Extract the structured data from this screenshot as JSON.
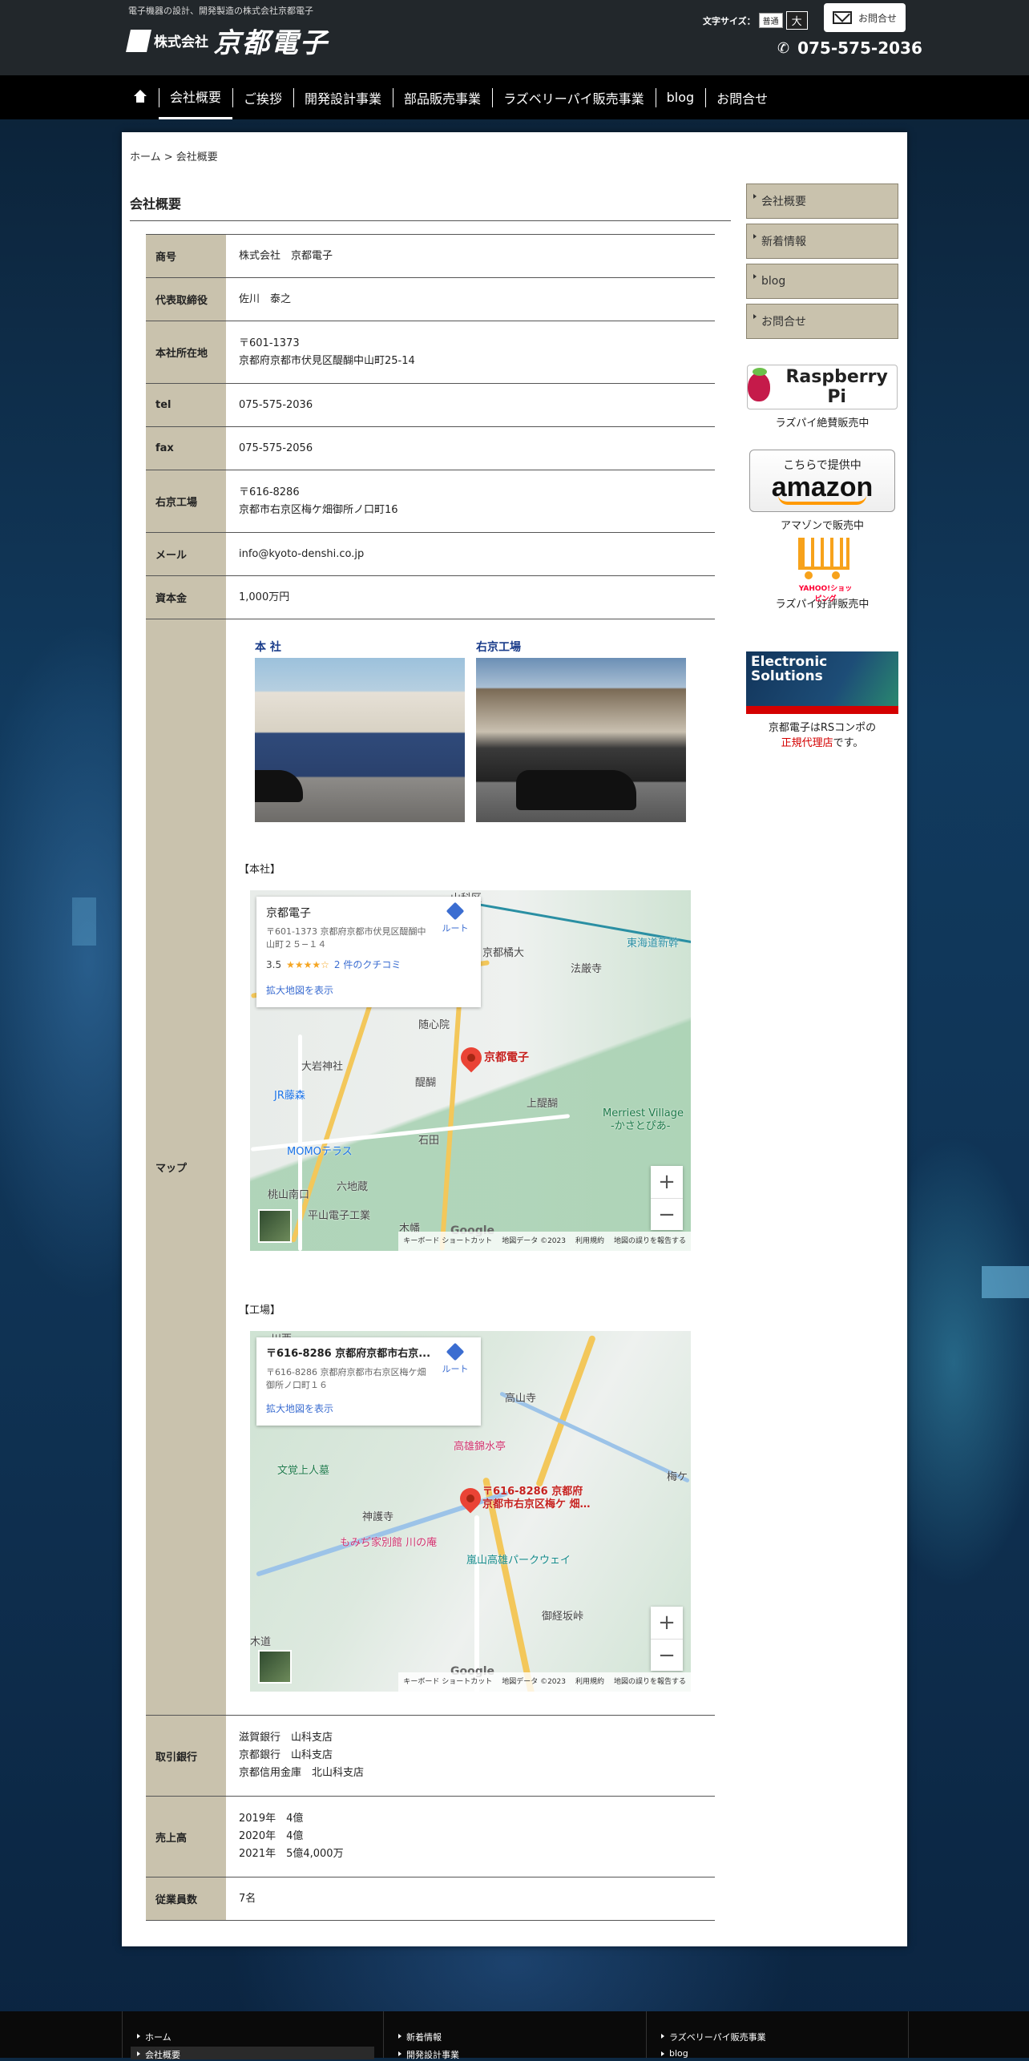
{
  "header": {
    "tagline": "電子機器の設計、開発製造の株式会社京都電子",
    "logo_prefix": "株式会社",
    "logo_name": "京都電子",
    "font_size_label": "文字サイズ：",
    "font_normal": "普通",
    "font_large": "大",
    "contact_label": "お問合せ",
    "phone": "075-575-2036"
  },
  "nav": {
    "items": [
      "会社概要",
      "ご挨拶",
      "開発設計事業",
      "部品販売事業",
      "ラズベリーパイ販売事業",
      "blog",
      "お問合せ"
    ],
    "active": "会社概要"
  },
  "breadcrumb": {
    "home": "ホーム",
    "sep": " > ",
    "current": "会社概要"
  },
  "page_title": "会社概要",
  "company": {
    "name_label": "商号",
    "name": "株式会社　京都電子",
    "rep_label": "代表取締役",
    "rep": "佐川　泰之",
    "hq_label": "本社所在地",
    "hq_zip": "〒601-1373",
    "hq_addr": "京都府京都市伏見区醍醐中山町25-14",
    "tel_label": "tel",
    "tel": "075-575-2036",
    "fax_label": "fax",
    "fax": "075-575-2056",
    "factory_label": "右京工場",
    "factory_zip": "〒616-8286",
    "factory_addr": "京都市右京区梅ケ畑御所ノ口町16",
    "mail_label": "メール",
    "mail": "info@kyoto-denshi.co.jp",
    "capital_label": "資本金",
    "capital": "1,000万円",
    "map_label": "マップ",
    "bank_label": "取引銀行",
    "banks": [
      "滋賀銀行　山科支店",
      "京都銀行　山科支店",
      "京都信用金庫　北山科支店"
    ],
    "sales_label": "売上高",
    "sales": [
      "2019年　4億",
      "2020年　4億",
      "2021年　5億4,000万"
    ],
    "staff_label": "従業員数",
    "staff": "7名"
  },
  "photos": {
    "hq_caption": "本 社",
    "factory_caption": "右京工場"
  },
  "maps": {
    "hq_section": "【本社】",
    "factory_section": "【工場】",
    "hq": {
      "title": "京都電子",
      "addr": "〒601-1373 京都府京都市伏見区醍醐中山町２５−１４",
      "rating": "3.5",
      "stars": "★★★★☆",
      "reviews": "2 件のクチコミ",
      "enlarge": "拡大地図を表示",
      "route": "ルート",
      "pin_label": "京都電子",
      "labels": [
        "京都橘大",
        "法厳寺",
        "随心院",
        "大岩神社",
        "醍醐",
        "JR藤森",
        "上醍醐",
        "Merriest Village",
        "-かさとぴあ-",
        "MOMOテラス",
        "石田",
        "六地蔵",
        "桃山南口",
        "平山電子工業",
        "木幡",
        "東海道新幹",
        "山科区"
      ]
    },
    "factory": {
      "title": "〒616-8286 京都府京都市右京...",
      "addr": "〒616-8286 京都府京都市右京区梅ケ畑御所ノ口町１６",
      "enlarge": "拡大地図を表示",
      "route": "ルート",
      "pin_label": "〒616-8286 京都府",
      "pin_label2": "京都市右京区梅ケ 畑…",
      "labels": [
        "高山寺",
        "高雄錦水亭",
        "文覚上人墓",
        "神護寺",
        "もみぢ家別館 川の庵",
        "嵐山高雄パークウェイ",
        "御経坂峠",
        "川西",
        "梅ケ",
        "木道"
      ]
    },
    "zoom_in": "+",
    "zoom_out": "−",
    "google": "Google",
    "footer": [
      "キーボード ショートカット",
      "地図データ ©2023",
      "利用規約",
      "地図の誤りを報告する"
    ]
  },
  "sidebar": {
    "items": [
      "会社概要",
      "新着情報",
      "blog",
      "お問合せ"
    ],
    "rpi_logo": "Raspberry Pi",
    "rpi_caption": "ラズパイ絶賛販売中",
    "amazon_top": "こちらで提供中",
    "amazon_name": "amazon",
    "amazon_caption": "アマゾンで販売中",
    "yahoo_logo": "YAHOO!ショッピング",
    "yahoo_caption": "ラズパイ好評販売中",
    "es_title": "Electronic Solutions",
    "es_caption1": "京都電子はRSコンポの",
    "es_caption_link": "正規代理店",
    "es_caption_end": "です。"
  },
  "footer": {
    "col1": [
      "ホーム",
      "会社概要"
    ],
    "col2": [
      "新着情報",
      "開発設計事業"
    ],
    "col3": [
      "ラズベリーパイ販売事業",
      "blog"
    ]
  },
  "colors": {
    "header_bg": "#22272b",
    "nav_bg": "#000000",
    "table_head": "#c9c2ad",
    "accent_red": "#d40000"
  }
}
